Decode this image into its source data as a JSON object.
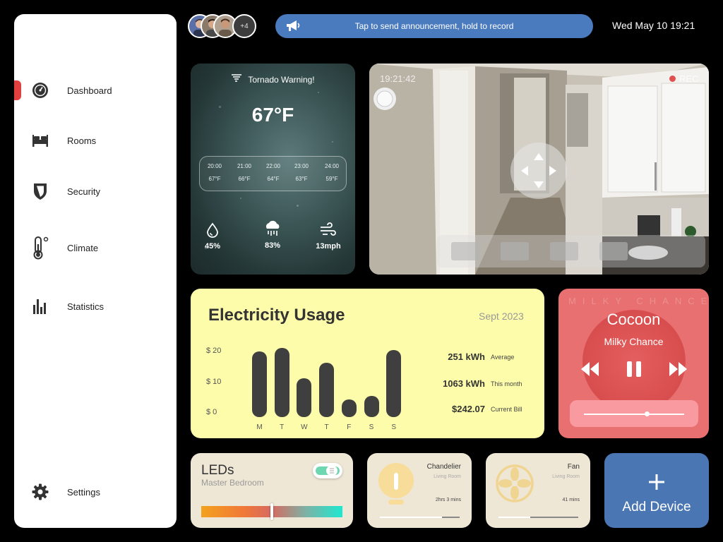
{
  "sidebar": {
    "items": [
      {
        "label": "Dashboard",
        "icon": "gauge-icon",
        "active": true
      },
      {
        "label": "Rooms",
        "icon": "bed-icon"
      },
      {
        "label": "Security",
        "icon": "shield-icon"
      },
      {
        "label": "Climate",
        "icon": "thermometer-icon"
      },
      {
        "label": "Statistics",
        "icon": "bar-chart-icon"
      }
    ],
    "settings_label": "Settings",
    "accent": "#e04040"
  },
  "header": {
    "avatar_extra": "+4",
    "announcement": "Tap to send announcement, hold to record",
    "datetime": "Wed May 10  19:21"
  },
  "weather": {
    "alert": "Tornado Warning!",
    "temperature": "67°F",
    "hourly": [
      {
        "time": "20:00",
        "temp": "67°F"
      },
      {
        "time": "21:00",
        "temp": "66°F"
      },
      {
        "time": "22:00",
        "temp": "64°F"
      },
      {
        "time": "23:00",
        "temp": "63°F"
      },
      {
        "time": "24:00",
        "temp": "59°F"
      }
    ],
    "stats": [
      {
        "icon": "humidity-icon",
        "value": "45%"
      },
      {
        "icon": "rain-cloud-icon",
        "value": "83%"
      },
      {
        "icon": "wind-icon",
        "value": "13mph"
      }
    ]
  },
  "camera": {
    "timestamp": "19:21:42",
    "rec_label": "REC"
  },
  "electricity": {
    "title": "Electricity Usage",
    "period": "Sept 2023",
    "stats": [
      {
        "value": "251 kWh",
        "label": "Average"
      },
      {
        "value": "1063 kWh",
        "label": "This month"
      },
      {
        "value": "$242.07",
        "label": "Current Bill"
      }
    ]
  },
  "chart_data": {
    "type": "bar",
    "title": "Electricity Usage",
    "categories": [
      "M",
      "T",
      "W",
      "T",
      "F",
      "S",
      "S"
    ],
    "values": [
      20.5,
      21.5,
      12,
      17,
      5.5,
      6.5,
      21
    ],
    "ylim": [
      0,
      22
    ],
    "yticks": [
      "$ 20",
      "$ 10",
      "$ 0"
    ],
    "bar_color": "#3f3f3f"
  },
  "music": {
    "ghost_text": "MILKY CHANCE",
    "title": "Cocoon",
    "artist": "Milky Chance",
    "progress": 0.63,
    "card_color": "#e87070"
  },
  "leds": {
    "title": "LEDs",
    "room": "Master Bedroom",
    "on": true,
    "color_position": 0.5
  },
  "devices": [
    {
      "name": "Chandelier",
      "room": "Living Room",
      "duration": "2hrs 3 mins",
      "icon": "lightbulb-icon",
      "progress": 0.22
    },
    {
      "name": "Fan",
      "room": "Living Room",
      "duration": "41 mins",
      "icon": "fan-icon",
      "progress": 0.6
    }
  ],
  "add_device": {
    "label": "Add Device",
    "color": "#4a77b4"
  }
}
